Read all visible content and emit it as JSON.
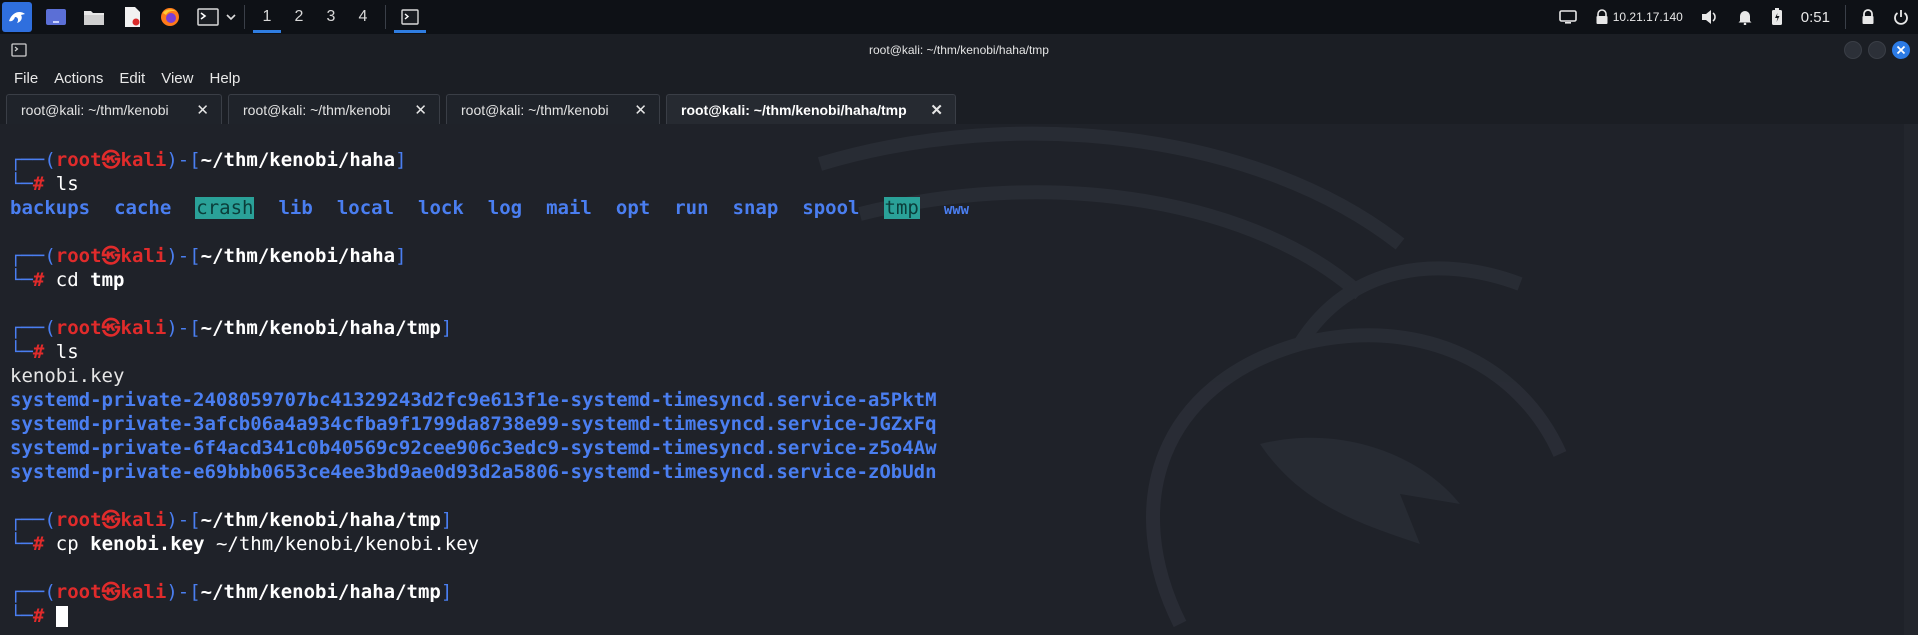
{
  "panel": {
    "workspaces": [
      "1",
      "2",
      "3",
      "4"
    ],
    "ip": "10.21.17.140",
    "time": "0:51"
  },
  "window": {
    "title": "root@kali: ~/thm/kenobi/haha/tmp",
    "menu": [
      "File",
      "Actions",
      "Edit",
      "View",
      "Help"
    ],
    "tabs": [
      {
        "label": "root@kali: ~/thm/kenobi"
      },
      {
        "label": "root@kali: ~/thm/kenobi"
      },
      {
        "label": "root@kali: ~/thm/kenobi"
      },
      {
        "label": "root@kali: ~/thm/kenobi/haha/tmp"
      }
    ],
    "tab_close_glyph": "✕"
  },
  "terminal": {
    "prompt_user": "root",
    "prompt_sep": "㉿",
    "prompt_host": "kali",
    "blocks": [
      {
        "path": "~/thm/kenobi/haha",
        "cmd": "ls"
      },
      {
        "path": "~/thm/kenobi/haha",
        "cmd": "cd",
        "arg": "tmp"
      },
      {
        "path": "~/thm/kenobi/haha/tmp",
        "cmd": "ls"
      },
      {
        "path": "~/thm/kenobi/haha/tmp",
        "cmd": "cp",
        "arg": "kenobi.key",
        "arg2": "~/thm/kenobi/kenobi.key"
      },
      {
        "path": "~/thm/kenobi/haha/tmp",
        "cmd": ""
      }
    ],
    "ls_dirs": [
      "backups",
      "cache",
      "crash",
      "lib",
      "local",
      "lock",
      "log",
      "mail",
      "opt",
      "run",
      "snap",
      "spool",
      "tmp",
      "www"
    ],
    "ls_tmp": {
      "file": "kenobi.key",
      "entries": [
        "systemd-private-2408059707bc41329243d2fc9e613f1e-systemd-timesyncd.service-a5PktM",
        "systemd-private-3afcb06a4a934cfba9f1799da8738e99-systemd-timesyncd.service-JGZxFq",
        "systemd-private-6f4acd341c0b40569c92cee906c3edc9-systemd-timesyncd.service-z5o4Aw",
        "systemd-private-e69bbb0653ce4ee3bd9ae0d93d2a5806-systemd-timesyncd.service-zObUdn"
      ]
    }
  },
  "colors": {
    "accent": "#2f7de1",
    "prompt_frame": "#4a7ef0",
    "root_red": "#e02b2b",
    "highlight_teal": "#2aa198"
  }
}
